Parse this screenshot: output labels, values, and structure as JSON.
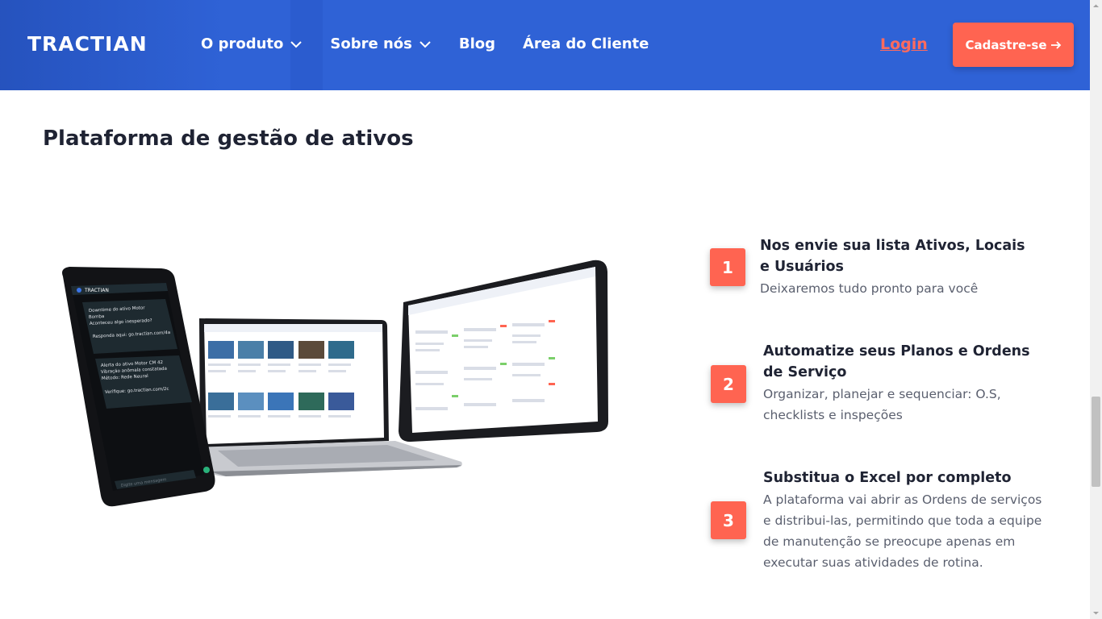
{
  "header": {
    "logo": "TRACTIAN",
    "nav": [
      {
        "label": "O produto",
        "dropdown": true
      },
      {
        "label": "Sobre nós",
        "dropdown": true
      },
      {
        "label": "Blog",
        "dropdown": false
      },
      {
        "label": "Área do Cliente",
        "dropdown": false
      }
    ],
    "login_label": "Login",
    "signup_label": "Cadastre-se",
    "colors": {
      "background": "#2f62d6",
      "accent": "#ff6451"
    }
  },
  "section": {
    "title": "Plataforma de gestão de ativos"
  },
  "devices": {
    "phone": {
      "app_name": "TRACTIAN",
      "messages": [
        {
          "line1": "Downtime do ativo Motor",
          "line2": "Bomba",
          "line3": "Aconteceu algo inesperado?",
          "line4": "Responda aqui: go.tractian.com/4a"
        },
        {
          "line1": "Alerta do ativo Motor CM 42",
          "line2": "Vibração anômala constatada",
          "line3": "Método: Rede Neural",
          "line4": "Verifique: go.tractian.com/2c"
        }
      ],
      "input_placeholder": "Digite uma mensagem"
    }
  },
  "steps": [
    {
      "number": "1",
      "title": "Nos envie sua lista Ativos, Locais e Usuários",
      "description": "Deixaremos tudo pronto para você"
    },
    {
      "number": "2",
      "title": "Automatize seus Planos e Ordens de Serviço",
      "description": "Organizar, planejar e sequenciar: O.S, checklists e inspeções"
    },
    {
      "number": "3",
      "title": "Substitua o Excel por completo",
      "description": "A plataforma vai abrir as Ordens de serviços e distribui-las, permitindo que toda a equipe de manutenção se preocupe apenas em executar suas atividades de rotina."
    }
  ]
}
